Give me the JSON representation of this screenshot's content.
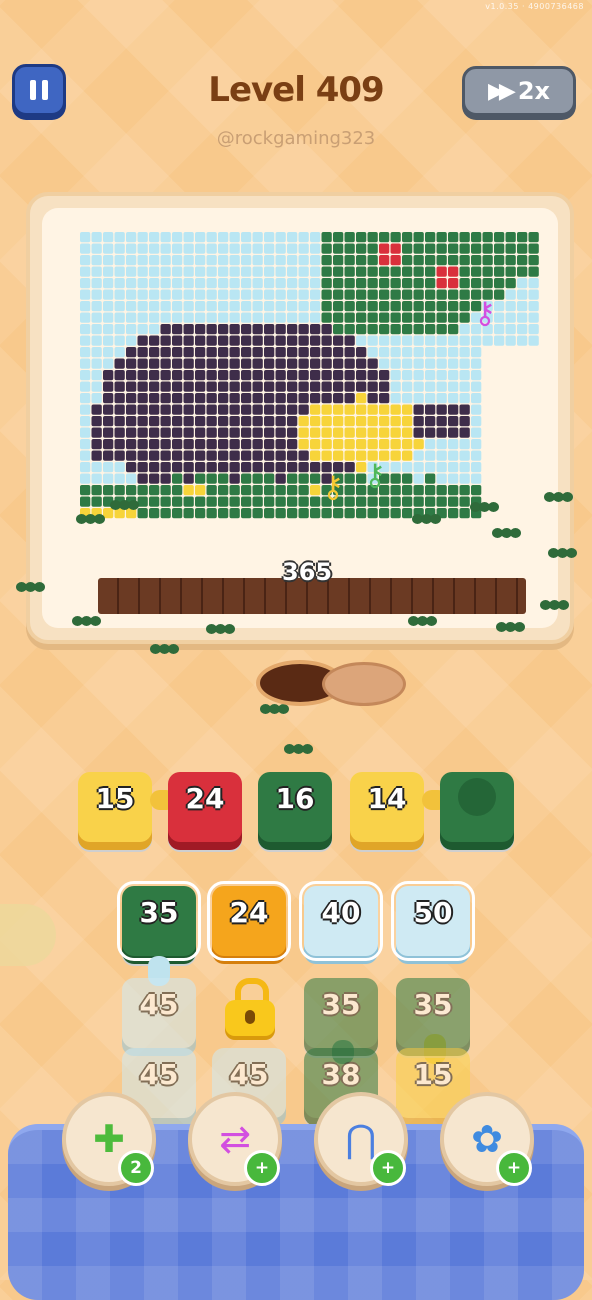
{
  "status_text": "v1.0.35 · 4900736468",
  "header": {
    "level_title": "Level 409",
    "handle": "@rockgaming323",
    "speed_label": "2x",
    "pause_icon": "pause-icon",
    "speed_icon": "fast-forward-icon"
  },
  "board": {
    "remaining_count": "365",
    "colors": {
      "sky": "#b9e6f3",
      "dark": "#3e2d4a",
      "green": "#2e7a45",
      "red": "#d9303c",
      "yellow": "#f7d43a",
      "soil": "#6b3a23"
    },
    "keys": [
      "magenta-key-icon",
      "yellow-key-icon",
      "green-key-icon"
    ]
  },
  "queue": [
    {
      "value": "15",
      "color": "yellow"
    },
    {
      "value": "24",
      "color": "red"
    },
    {
      "value": "16",
      "color": "green"
    },
    {
      "value": "14",
      "color": "yellow"
    },
    {
      "value": "",
      "color": "green"
    }
  ],
  "stacks": {
    "row1": [
      {
        "value": "35",
        "color": "green"
      },
      {
        "value": "24",
        "color": "orange"
      },
      {
        "value": "40",
        "color": "lightblue"
      },
      {
        "value": "50",
        "color": "lightblue"
      }
    ],
    "row2": [
      {
        "value": "45",
        "color": "lightblue"
      },
      {
        "value": "",
        "color": "locked"
      },
      {
        "value": "35",
        "color": "green"
      },
      {
        "value": "35",
        "color": "green"
      }
    ],
    "row3": [
      {
        "value": "45",
        "color": "lightblue"
      },
      {
        "value": "45",
        "color": "lightblue"
      },
      {
        "value": "38",
        "color": "green"
      },
      {
        "value": "15",
        "color": "yellow"
      }
    ]
  },
  "powerups": [
    {
      "icon": "add-slot-icon",
      "badge": "2"
    },
    {
      "icon": "swap-arrows-icon",
      "badge": "+"
    },
    {
      "icon": "magnet-claw-icon",
      "badge": "+"
    },
    {
      "icon": "shuffle-gear-icon",
      "badge": "+"
    }
  ]
}
